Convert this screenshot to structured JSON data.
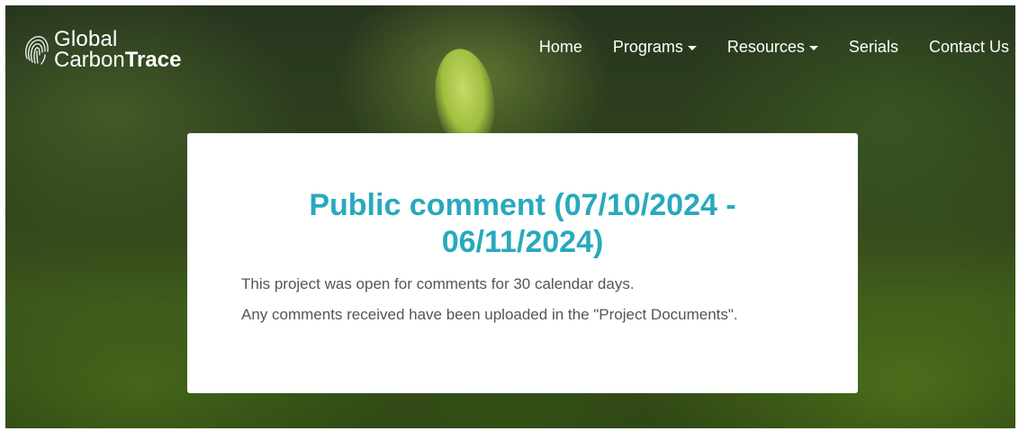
{
  "brand": {
    "line1": "Global",
    "line2_light": "Carbon",
    "line2_bold": "Trace"
  },
  "nav": {
    "home": "Home",
    "programs": "Programs",
    "resources": "Resources",
    "serials": "Serials",
    "contact": "Contact Us"
  },
  "card": {
    "title": "Public comment (07/10/2024 - 06/11/2024)",
    "paragraph1": "This project was open for comments for 30 calendar days.",
    "paragraph2": "Any comments received have been uploaded in the \"Project Documents\"."
  },
  "colors": {
    "accent": "#28a9bd",
    "body_text": "#555555",
    "nav_text": "#ffffff"
  }
}
